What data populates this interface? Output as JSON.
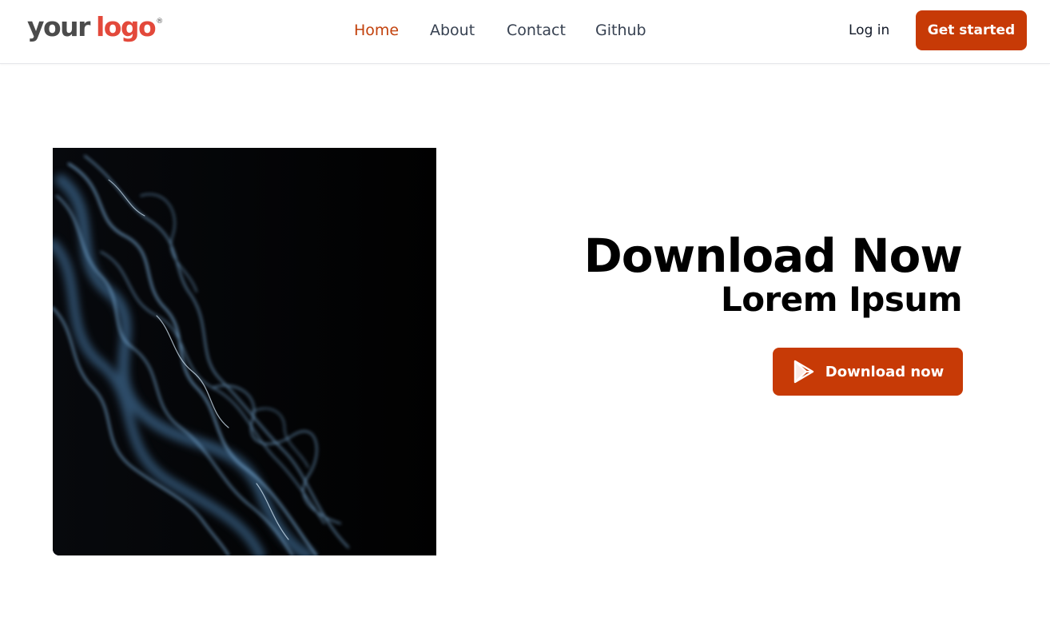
{
  "brand": {
    "logo_word1": "your",
    "logo_word2": "logo",
    "logo_mark": "®",
    "logo_color_dark": "#4b4b4b",
    "logo_color_accent": "#e3493b"
  },
  "nav": {
    "links": [
      {
        "label": "Home",
        "active": true
      },
      {
        "label": "About",
        "active": false
      },
      {
        "label": "Contact",
        "active": false
      },
      {
        "label": "Github",
        "active": false
      }
    ],
    "login_label": "Log in",
    "cta_label": "Get started"
  },
  "hero": {
    "image_alt": "",
    "image_icon": "smoke-image",
    "headline": "Download Now",
    "subheadline": "Lorem Ipsum",
    "download_label": "Download now",
    "download_icon": "play-store-icon"
  },
  "colors": {
    "accent": "#c73a06",
    "active_link": "#c2410c",
    "text_dark": "#000000",
    "nav_text": "#374151"
  }
}
